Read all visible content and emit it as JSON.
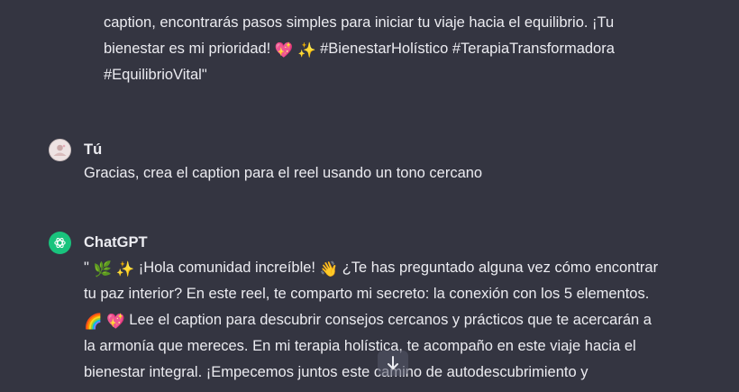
{
  "previous_message": {
    "lines": [
      {
        "parts": [
          {
            "t": "caption, encontrarás pasos simples para iniciar tu viaje hacia el equilibrio. ¡Tu"
          }
        ]
      },
      {
        "parts": [
          {
            "t": "bienestar es mi prioridad! "
          },
          {
            "emoji": "💖"
          },
          {
            "t": " "
          },
          {
            "emoji": "✨"
          },
          {
            "t": " #BienestarHolístico #TerapiaTransformadora"
          }
        ]
      },
      {
        "parts": [
          {
            "t": "#EquilibrioVital\""
          }
        ]
      }
    ]
  },
  "user_message": {
    "author": "Tú",
    "text": "Gracias, crea el caption para el reel usando un tono cercano"
  },
  "assistant_message": {
    "author": "ChatGPT",
    "lines": [
      {
        "parts": [
          {
            "t": "\" "
          },
          {
            "emoji": "🌿"
          },
          {
            "t": " "
          },
          {
            "emoji": "✨"
          },
          {
            "t": " ¡Hola comunidad increíble! "
          },
          {
            "emoji": "👋"
          },
          {
            "t": " ¿Te has preguntado alguna vez cómo encontrar"
          }
        ]
      },
      {
        "parts": [
          {
            "t": "tu paz interior? En este reel, te comparto mi secreto: la conexión con los 5 elementos."
          }
        ]
      },
      {
        "parts": [
          {
            "emoji": "🌈"
          },
          {
            "t": " "
          },
          {
            "emoji": "💖"
          },
          {
            "t": " Lee el caption para descubrir consejos cercanos y prácticos que te acercarán a"
          }
        ]
      },
      {
        "parts": [
          {
            "t": "la armonía que mereces. En mi terapia holística, te acompaño en este viaje hacia el"
          }
        ]
      },
      {
        "parts": [
          {
            "t": "bienestar integral. ¡Empecemos juntos este camino de autodescubrimiento y"
          }
        ]
      }
    ]
  },
  "icons": {
    "user_avatar": "user-avatar-icon",
    "gpt_avatar": "openai-logo-icon",
    "scroll": "arrow-down-icon"
  },
  "colors": {
    "background": "#343541",
    "text": "#ececf1",
    "gpt_green": "#19c37d"
  }
}
